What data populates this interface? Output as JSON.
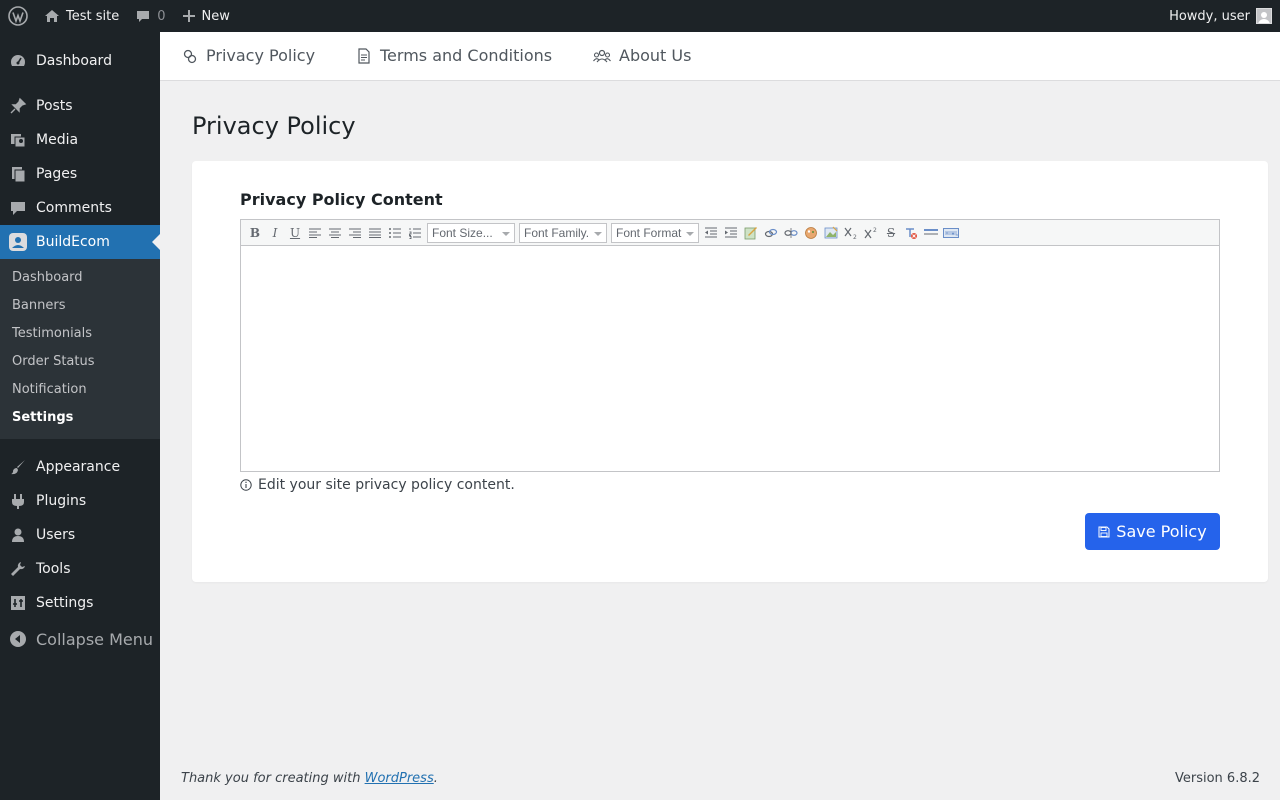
{
  "adminbar": {
    "site_name": "Test site",
    "comments_count": "0",
    "new_label": "New",
    "howdy": "Howdy, user"
  },
  "sidebar": {
    "items": [
      {
        "label": "Dashboard",
        "icon": "dashboard-icon"
      },
      {
        "label": "Posts",
        "icon": "pin-icon"
      },
      {
        "label": "Media",
        "icon": "media-icon"
      },
      {
        "label": "Pages",
        "icon": "pages-icon"
      },
      {
        "label": "Comments",
        "icon": "comment-icon"
      },
      {
        "label": "BuildEcom",
        "icon": "buildecom-icon",
        "active": true
      },
      {
        "label": "Appearance",
        "icon": "brush-icon"
      },
      {
        "label": "Plugins",
        "icon": "plugin-icon"
      },
      {
        "label": "Users",
        "icon": "user-icon"
      },
      {
        "label": "Tools",
        "icon": "wrench-icon"
      },
      {
        "label": "Settings",
        "icon": "settings-icon"
      }
    ],
    "submenu": [
      "Dashboard",
      "Banners",
      "Testimonials",
      "Order Status",
      "Notification",
      "Settings"
    ],
    "current_submenu": "Settings",
    "collapse_label": "Collapse Menu"
  },
  "tabs": [
    {
      "label": "Privacy Policy",
      "icon": "privacy-icon"
    },
    {
      "label": "Terms and Conditions",
      "icon": "document-icon"
    },
    {
      "label": "About Us",
      "icon": "group-icon"
    }
  ],
  "page": {
    "title": "Privacy Policy",
    "field_label": "Privacy Policy Content",
    "editor": {
      "font_size_placeholder": "Font Size...",
      "font_family_placeholder": "Font Family.",
      "font_format_placeholder": "Font Format",
      "content": ""
    },
    "help_text": "Edit your site privacy policy content.",
    "save_label": "Save Policy"
  },
  "footer": {
    "thank_you": "Thank you for creating with",
    "link_text": "WordPress",
    "period": ".",
    "version": "Version 6.8.2"
  },
  "colors": {
    "accent": "#2271b1",
    "save_button": "#2563eb",
    "sidebar_bg": "#1d2327",
    "submenu_bg": "#2c3338"
  }
}
